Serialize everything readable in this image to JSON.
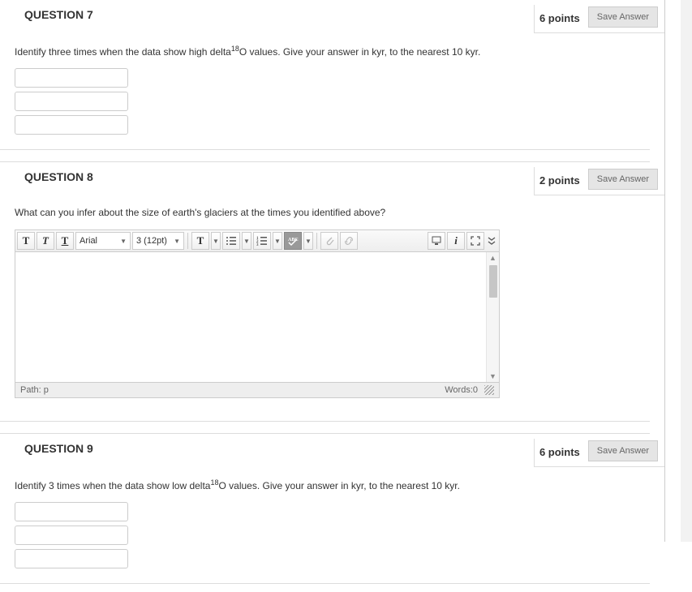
{
  "questions": [
    {
      "title": "QUESTION 7",
      "points": "6 points",
      "save": "Save Answer",
      "prompt_pre": "Identify three times when the data show high delta",
      "prompt_sup": "18",
      "prompt_post": "O values.  Give your answer in kyr, to the nearest 10 kyr.",
      "inputs": [
        "",
        "",
        ""
      ]
    },
    {
      "title": "QUESTION 8",
      "points": "2 points",
      "save": "Save Answer",
      "prompt": "What can you infer about the size of earth's glaciers at the times you identified above?",
      "editor": {
        "font_family": "Arial",
        "font_size": "3 (12pt)",
        "bold": "T",
        "italic": "T",
        "underline": "T",
        "path_label": "Path: p",
        "words_label": "Words:0"
      }
    },
    {
      "title": "QUESTION 9",
      "points": "6 points",
      "save": "Save Answer",
      "prompt_pre": "Identify 3 times when the data show low delta",
      "prompt_sup": "18",
      "prompt_post": "O values.  Give your answer in kyr, to the nearest 10 kyr.",
      "inputs": [
        "",
        "",
        ""
      ]
    }
  ]
}
